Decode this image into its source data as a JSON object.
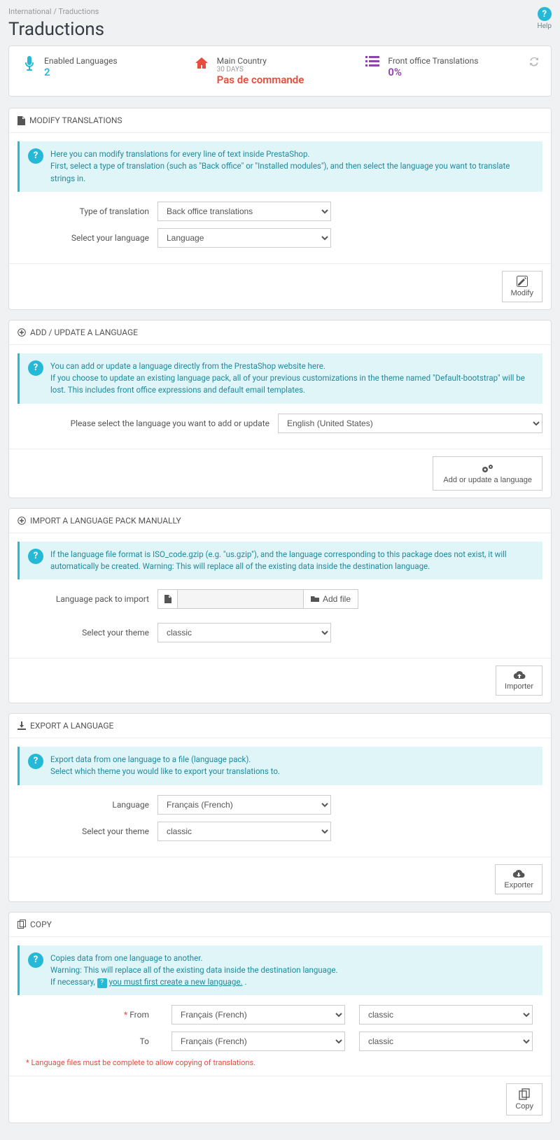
{
  "breadcrumb": {
    "parent": "International",
    "sep": "/",
    "current": "Traductions"
  },
  "title": "Traductions",
  "help": {
    "label": "Help",
    "icon": "?"
  },
  "stats": {
    "languages": {
      "label": "Enabled Languages",
      "value": "2"
    },
    "country": {
      "label": "Main Country",
      "sub": "30 DAYS",
      "value": "Pas de commande"
    },
    "translations": {
      "label": "Front office Translations",
      "value": "0%"
    }
  },
  "modify": {
    "heading": "MODIFY TRANSLATIONS",
    "info_line1": "Here you can modify translations for every line of text inside PrestaShop.",
    "info_line2": "First, select a type of translation (such as \"Back office\" or \"Installed modules\"), and then select the language you want to translate strings in.",
    "type_label": "Type of translation",
    "type_value": "Back office translations",
    "lang_label": "Select your language",
    "lang_value": "Language",
    "button": "Modify"
  },
  "add": {
    "heading": "ADD / UPDATE A LANGUAGE",
    "info_line1": "You can add or update a language directly from the PrestaShop website here.",
    "info_line2": "If you choose to update an existing language pack, all of your previous customizations in the theme named \"Default-bootstrap\" will be lost. This includes front office expressions and default email templates.",
    "select_label": "Please select the language you want to add or update",
    "select_value": "English (United States)",
    "button": "Add or update a language"
  },
  "import": {
    "heading": "IMPORT A LANGUAGE PACK MANUALLY",
    "info": "If the language file format is ISO_code.gzip (e.g. \"us.gzip\"), and the language corresponding to this package does not exist, it will automatically be created. Warning: This will replace all of the existing data inside the destination language.",
    "pack_label": "Language pack to import",
    "addfile": "Add file",
    "theme_label": "Select your theme",
    "theme_value": "classic",
    "button": "Importer"
  },
  "export": {
    "heading": "EXPORT A LANGUAGE",
    "info_line1": "Export data from one language to a file (language pack).",
    "info_line2": "Select which theme you would like to export your translations to.",
    "lang_label": "Language",
    "lang_value": "Français (French)",
    "theme_label": "Select your theme",
    "theme_value": "classic",
    "button": "Exporter"
  },
  "copy": {
    "heading": "COPY",
    "info_line1": "Copies data from one language to another.",
    "info_line2": "Warning: This will replace all of the existing data inside the destination language.",
    "info_line3_prefix": "If necessary, ",
    "info_link": "you must first create a new language.",
    "from_label": "From",
    "to_label": "To",
    "lang_value": "Français (French)",
    "theme_value": "classic",
    "note": "Language files must be complete to allow copying of translations.",
    "button": "Copy"
  }
}
